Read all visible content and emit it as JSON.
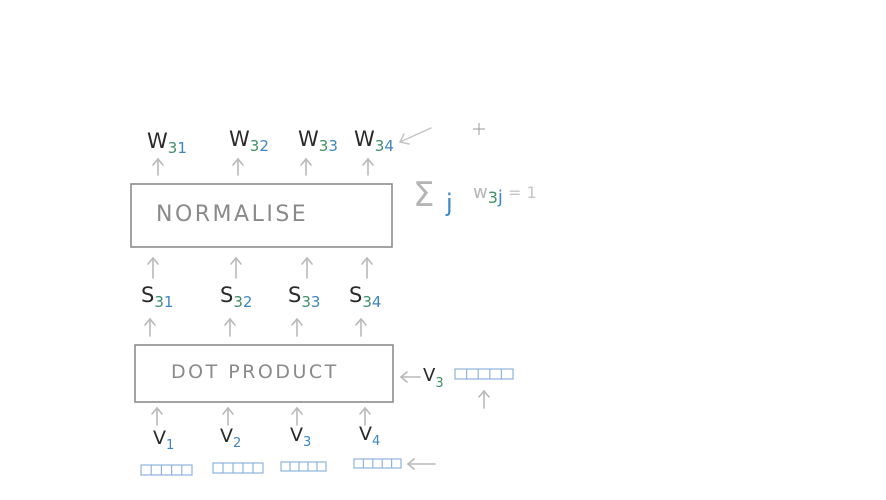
{
  "diagram": {
    "normalise_label": "NORMALISE",
    "dot_product_label": "DOT PRODUCT",
    "sum_formula": {
      "sigma": "Σ",
      "index": "j",
      "term_base": "w",
      "term_sub_a": "3",
      "term_sub_b": "j",
      "equals": "= 1"
    },
    "weights": [
      {
        "base": "W",
        "sub_a": "3",
        "sub_b": "1"
      },
      {
        "base": "W",
        "sub_a": "3",
        "sub_b": "2"
      },
      {
        "base": "W",
        "sub_a": "3",
        "sub_b": "3"
      },
      {
        "base": "W",
        "sub_a": "3",
        "sub_b": "4"
      }
    ],
    "scores": [
      {
        "base": "S",
        "sub_a": "3",
        "sub_b": "1"
      },
      {
        "base": "S",
        "sub_a": "3",
        "sub_b": "2"
      },
      {
        "base": "S",
        "sub_a": "3",
        "sub_b": "3"
      },
      {
        "base": "S",
        "sub_a": "3",
        "sub_b": "4"
      }
    ],
    "vectors": [
      {
        "base": "V",
        "sub": "1"
      },
      {
        "base": "V",
        "sub": "2"
      },
      {
        "base": "V",
        "sub": "3"
      },
      {
        "base": "V",
        "sub": "4"
      }
    ],
    "query": {
      "base": "V",
      "sub": "3"
    }
  },
  "colors": {
    "ink": "#2a2a2a",
    "box": "#8c8c8c",
    "arrow": "#b9b9b9",
    "sub_green": "#3f8f6a",
    "sub_blue": "#3f86c4",
    "vector_strip": "#8fb3dd",
    "formula_gray": "#b5b5b5"
  }
}
